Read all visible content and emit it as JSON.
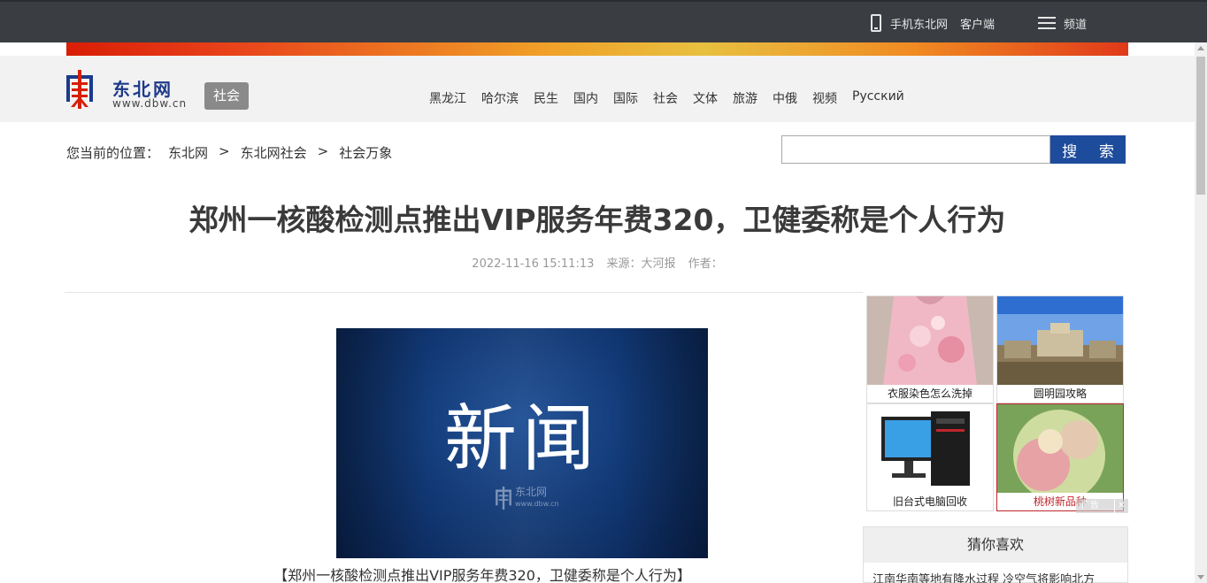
{
  "topbar": {
    "mobile_label": "手机东北网",
    "client_label": "客户端",
    "channel_label": "频道"
  },
  "header": {
    "logo_text": "东北网",
    "logo_url": "www.dbw.cn",
    "section_tag": "社会",
    "nav": [
      "黑龙江",
      "哈尔滨",
      "民生",
      "国内",
      "国际",
      "社会",
      "文体",
      "旅游",
      "中俄",
      "视频",
      "Русский"
    ]
  },
  "breadcrumb": {
    "prefix": "您当前的位置：",
    "items": [
      "东北网",
      "东北网社会",
      "社会万象"
    ],
    "separator": ">"
  },
  "search": {
    "value": "",
    "button_label": "搜 索"
  },
  "article": {
    "title": "郑州一核酸检测点推出VIP服务年费320，卫健委称是个人行为",
    "datetime": "2022-11-16 15:11:13",
    "source": "来源：大河报",
    "author": "作者：",
    "image_text": "新闻",
    "image_logo": "东北网",
    "image_logo_url": "www.dbw.cn",
    "caption": "【郑州一核酸检测点推出VIP服务年费320，卫健委称是个人行为】"
  },
  "ads": {
    "items": [
      {
        "label": "衣服染色怎么洗掉"
      },
      {
        "label": "圆明园攻略"
      },
      {
        "label": "旧台式电脑回收"
      },
      {
        "label": "桃树新品种"
      }
    ],
    "ad_mark": "广告",
    "close": "✕"
  },
  "guess": {
    "title": "猜你喜欢",
    "first_item": "江南华南等地有降水过程 冷空气将影响北方"
  },
  "colors": {
    "topbar_bg": "#3a3d42",
    "search_button": "#1e4c9c",
    "ad_selected": "#c0262c"
  }
}
